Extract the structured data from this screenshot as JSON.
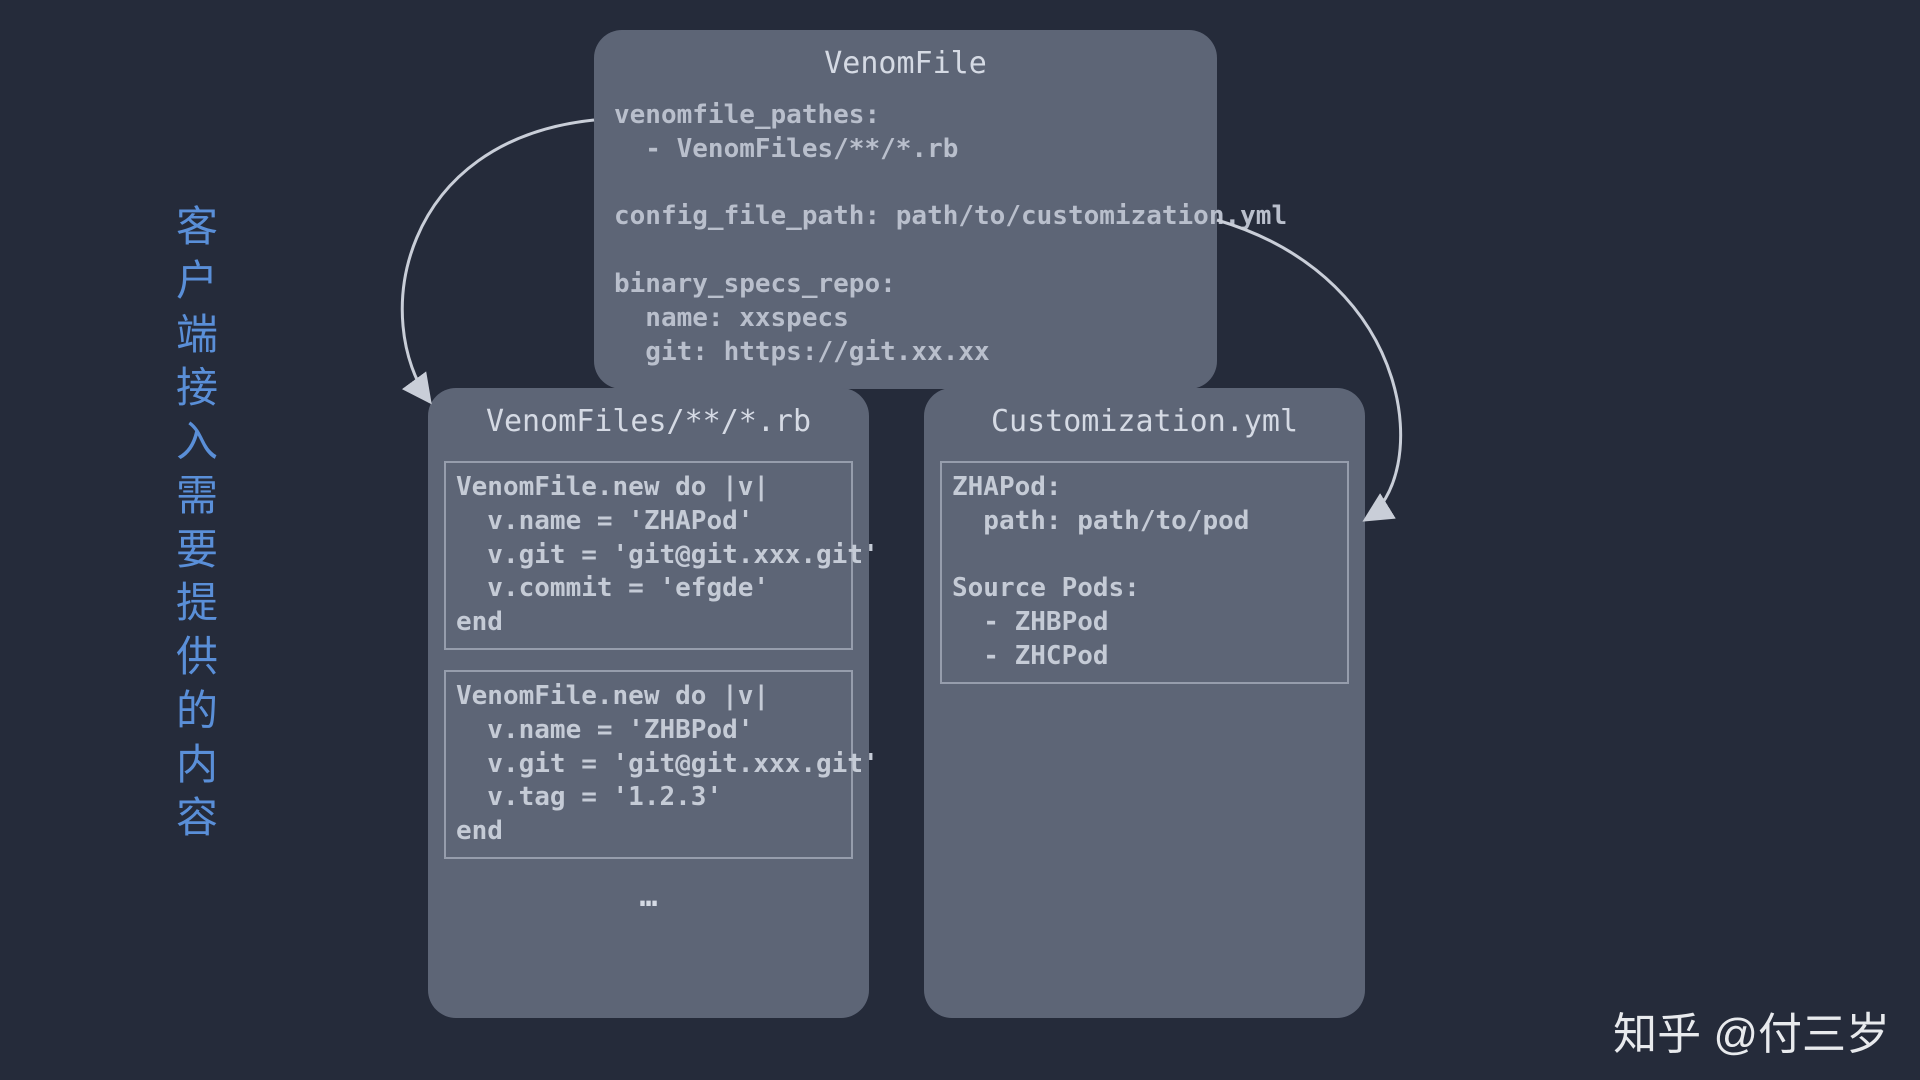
{
  "sidebar": {
    "label": "客户端接入需要提供的内容"
  },
  "top_box": {
    "title": "VenomFile",
    "content": "venomfile_pathes:\n  - VenomFiles/**/*.rb\n\nconfig_file_path: path/to/customization.yml\n\nbinary_specs_repo:\n  name: xxspecs\n  git: https://git.xx.xx"
  },
  "left_box": {
    "title": "VenomFiles/**/*.rb",
    "blocks": [
      "VenomFile.new do |v|\n  v.name = 'ZHAPod'\n  v.git = 'git@git.xxx.git'\n  v.commit = 'efgde'\nend",
      "VenomFile.new do |v|\n  v.name = 'ZHBPod'\n  v.git = 'git@git.xxx.git'\n  v.tag = '1.2.3'\nend"
    ],
    "ellipsis": "…"
  },
  "right_box": {
    "title": "Customization.yml",
    "content": "ZHAPod:\n  path: path/to/pod\n\nSource Pods:\n  - ZHBPod\n  - ZHCPod"
  },
  "watermark": "知乎 @付三岁"
}
